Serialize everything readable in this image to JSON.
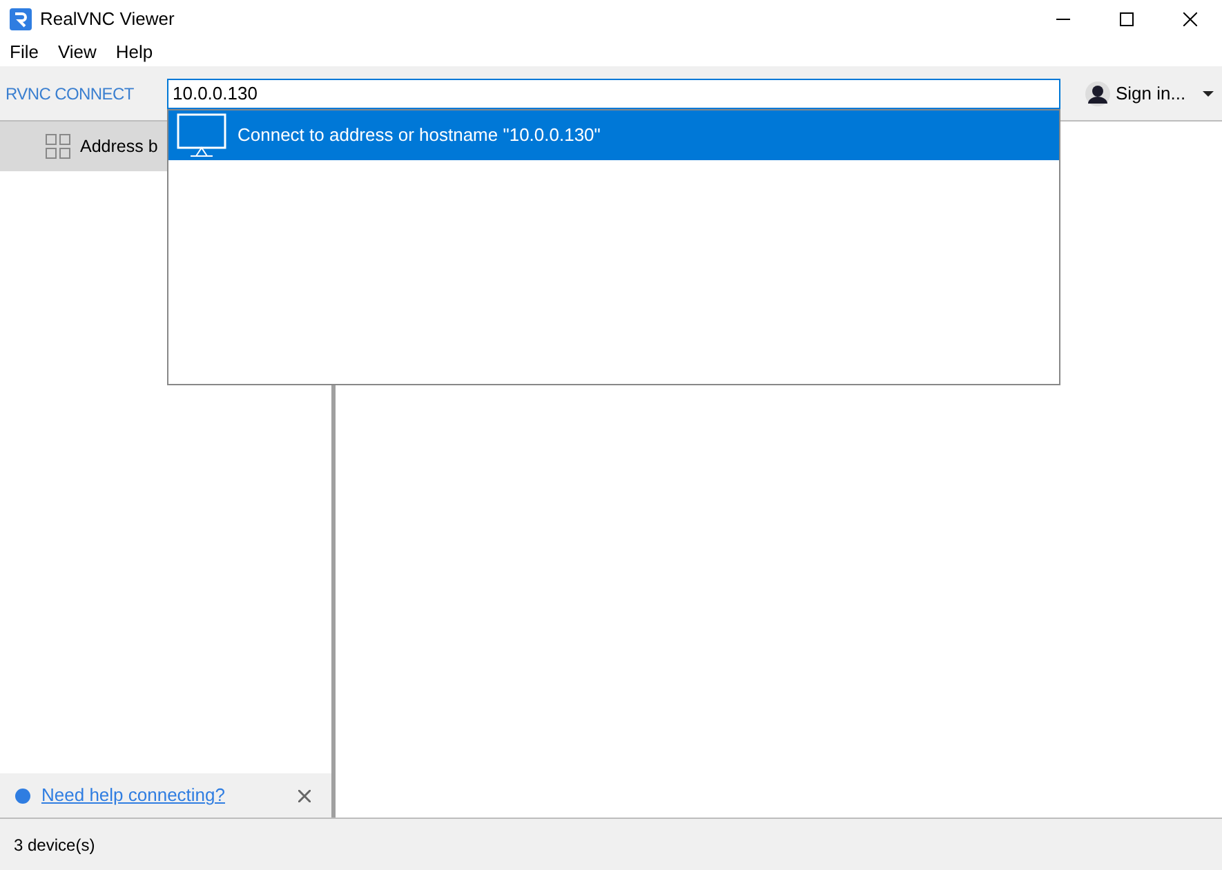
{
  "window": {
    "title": "RealVNC Viewer"
  },
  "menu": [
    "File",
    "View",
    "Help"
  ],
  "toolbar": {
    "logo": "RVNC CONNECT",
    "search": {
      "value": "10.0.0.130"
    },
    "sign_in": "Sign in..."
  },
  "suggestions": [
    {
      "label": "Connect to address or hostname \"10.0.0.130\"",
      "selected": true
    }
  ],
  "sidebar": {
    "items": [
      {
        "label": "Address b",
        "selected": true
      }
    ]
  },
  "help": {
    "link": "Need help connecting?"
  },
  "status_bar": "3 device(s)"
}
